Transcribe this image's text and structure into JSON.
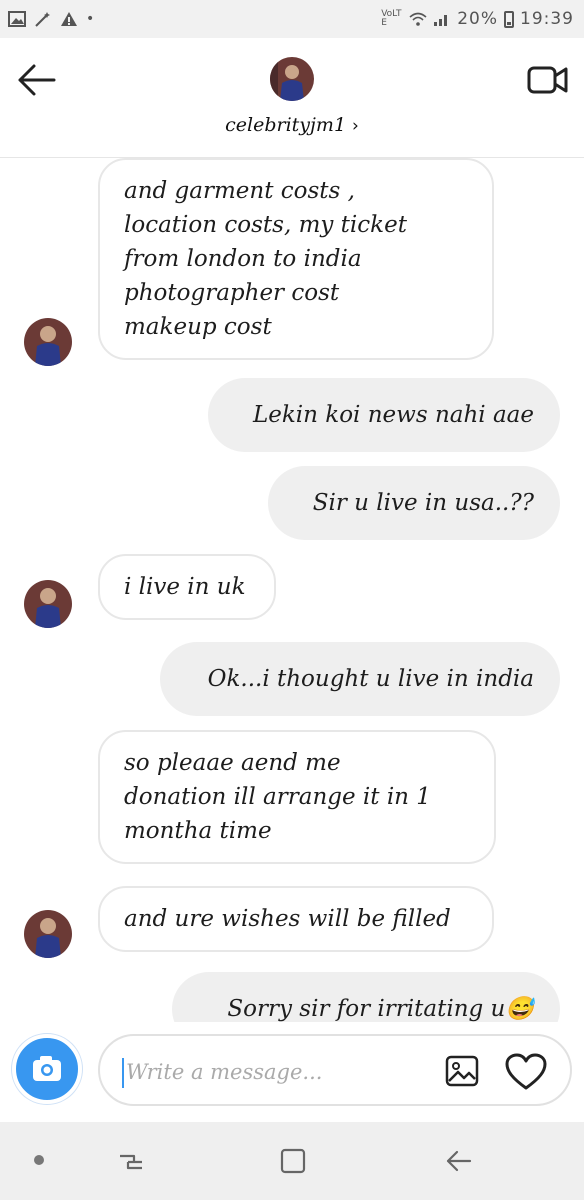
{
  "status_bar": {
    "signal_label": "VoLTE",
    "battery": "20%",
    "time": "19:39"
  },
  "header": {
    "username": "celebrityjm1",
    "chevron": "›"
  },
  "messages": [
    {
      "side": "incoming",
      "text": "and garment costs ,\nlocation costs, my ticket\nfrom london to india\nphotographer cost\nmakeup cost"
    },
    {
      "side": "outgoing",
      "text": "Lekin koi news nahi aae"
    },
    {
      "side": "outgoing",
      "text": "Sir u live in usa..??"
    },
    {
      "side": "incoming",
      "text": "i live in uk"
    },
    {
      "side": "outgoing",
      "text": "Ok...i thought u live in india"
    },
    {
      "side": "incoming",
      "text": "so pleaae aend me\ndonation ill arrange it in 1\nmontha time"
    },
    {
      "side": "incoming",
      "text": "and ure wishes will be filled"
    },
    {
      "side": "outgoing",
      "text": "Sorry sir for irritating u😅"
    }
  ],
  "composer": {
    "placeholder": "Write a message..."
  },
  "colors": {
    "accent": "#3897f0",
    "outgoing_bubble": "#efefef",
    "incoming_border": "#e7e7e7"
  },
  "icons": [
    "back-arrow-icon",
    "video-call-icon",
    "camera-icon",
    "gallery-icon",
    "heart-icon"
  ]
}
